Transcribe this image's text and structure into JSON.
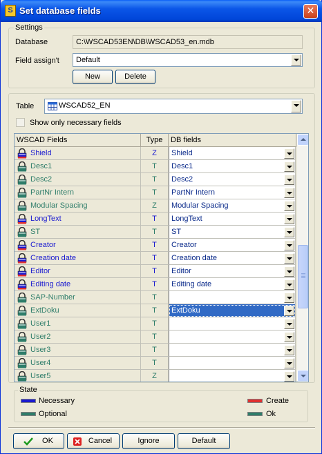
{
  "window": {
    "title": "Set database fields",
    "app_icon": "wscad-icon"
  },
  "settings": {
    "legend": "Settings",
    "database_label": "Database",
    "database_value": "C:\\WSCAD53EN\\DB\\WSCAD53_en.mdb",
    "field_assign_label": "Field assign't",
    "field_assign_value": "Default",
    "new_label": "New",
    "delete_label": "Delete"
  },
  "table": {
    "label": "Table",
    "value": "WSCAD52_EN",
    "show_necessary_label": "Show only necessary fields",
    "show_necessary_checked": false
  },
  "grid": {
    "columns": [
      "WSCAD Fields",
      "Type",
      "DB fields"
    ],
    "rows": [
      {
        "name": "Shield",
        "type": "Z",
        "db": "Shield",
        "kind": "necessary",
        "status": "create"
      },
      {
        "name": "Desc1",
        "type": "T",
        "db": "Desc1",
        "kind": "optional",
        "status": "ok"
      },
      {
        "name": "Desc2",
        "type": "T",
        "db": "Desc2",
        "kind": "optional",
        "status": "ok"
      },
      {
        "name": "PartNr Intern",
        "type": "T",
        "db": "PartNr Intern",
        "kind": "optional",
        "status": "ok"
      },
      {
        "name": "Modular Spacing",
        "type": "Z",
        "db": "Modular Spacing",
        "kind": "optional",
        "status": "ok"
      },
      {
        "name": "LongText",
        "type": "T",
        "db": "LongText",
        "kind": "necessary",
        "status": "create"
      },
      {
        "name": "ST",
        "type": "T",
        "db": "ST",
        "kind": "optional",
        "status": "ok"
      },
      {
        "name": "Creator",
        "type": "T",
        "db": "Creator",
        "kind": "necessary",
        "status": "create"
      },
      {
        "name": "Creation date",
        "type": "T",
        "db": "Creation date",
        "kind": "necessary",
        "status": "create"
      },
      {
        "name": "Editor",
        "type": "T",
        "db": "Editor",
        "kind": "necessary",
        "status": "create"
      },
      {
        "name": "Editing date",
        "type": "T",
        "db": "Editing date",
        "kind": "necessary",
        "status": "create"
      },
      {
        "name": "SAP-Number",
        "type": "T",
        "db": "",
        "kind": "optional",
        "status": "ok"
      },
      {
        "name": "ExtDoku",
        "type": "T",
        "db": "ExtDoku",
        "kind": "optional",
        "status": "ok",
        "selected": true
      },
      {
        "name": "User1",
        "type": "T",
        "db": "",
        "kind": "optional",
        "status": "ok"
      },
      {
        "name": "User2",
        "type": "T",
        "db": "",
        "kind": "optional",
        "status": "ok"
      },
      {
        "name": "User3",
        "type": "T",
        "db": "",
        "kind": "optional",
        "status": "ok"
      },
      {
        "name": "User4",
        "type": "T",
        "db": "",
        "kind": "optional",
        "status": "ok"
      },
      {
        "name": "User5",
        "type": "Z",
        "db": "",
        "kind": "optional",
        "status": "ok"
      }
    ],
    "scroll_position": 0.62
  },
  "state": {
    "legend": "State",
    "necessary_label": "Necessary",
    "optional_label": "Optional",
    "create_label": "Create",
    "ok_label": "Ok",
    "colors": {
      "necessary": "#1a1ad0",
      "optional": "#2e7d6a",
      "create": "#e03030",
      "ok": "#2e7d6a"
    }
  },
  "buttons": {
    "ok_label": "OK",
    "cancel_label": "Cancel",
    "ignore_label": "Ignore",
    "default_label": "Default"
  }
}
